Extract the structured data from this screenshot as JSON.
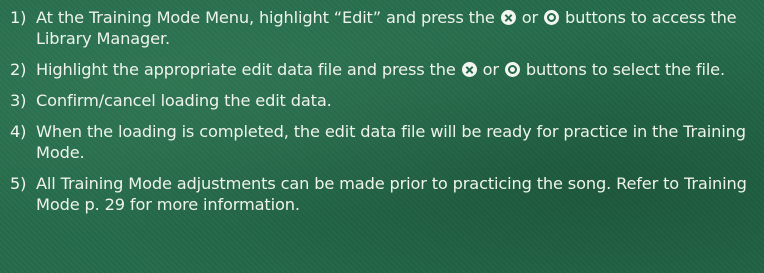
{
  "steps": [
    {
      "number": "1)",
      "parts": [
        "At the Training Mode Menu, highlight “Edit” and press the",
        "or",
        "buttons to access the Library Manager."
      ]
    },
    {
      "number": "2)",
      "parts": [
        "Highlight the appropriate edit data file and press the",
        "or",
        "buttons to select the file."
      ]
    },
    {
      "number": "3)",
      "text": "Confirm/cancel loading the edit data."
    },
    {
      "number": "4)",
      "text": "When the loading is completed, the edit data file will be ready for practice in the Training Mode."
    },
    {
      "number": "5)",
      "text": "All Training Mode adjustments can be made prior to practicing the song. Refer to Training Mode p. 29 for more information."
    }
  ],
  "icons": {
    "cross": "cross-button-icon",
    "circle": "circle-button-icon"
  },
  "colors": {
    "background": "#246a4a",
    "text": "#eef3ec"
  }
}
